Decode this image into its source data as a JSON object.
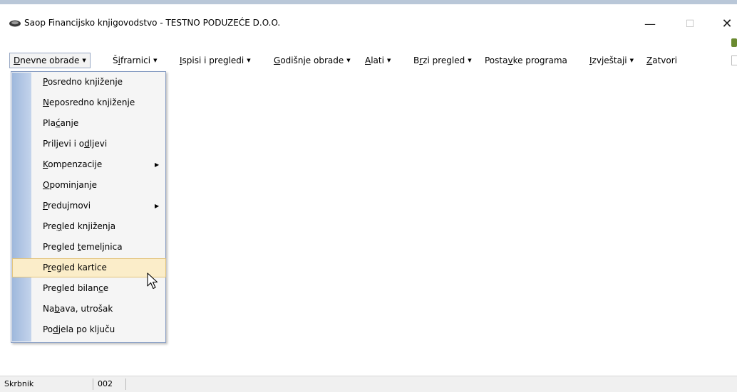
{
  "window": {
    "title": "Saop Financijsko knjigovodstvo - TESTNO PODUZEĆE D.O.O.",
    "minimize_glyph": "—",
    "maximize_glyph": "☐",
    "close_glyph": "✕"
  },
  "menubar": {
    "items": [
      {
        "label": "Dnevne obrade",
        "pre": "",
        "u": "D",
        "post": "nevne obrade",
        "dropdown": true,
        "active": true
      },
      {
        "label": "Šifrarnici",
        "pre": "Š",
        "u": "i",
        "post": "frarnici",
        "dropdown": true
      },
      {
        "label": "Ispisi i pregledi",
        "pre": "",
        "u": "I",
        "post": "spisi i pregledi",
        "dropdown": true
      },
      {
        "label": "Godišnje obrade",
        "pre": "",
        "u": "G",
        "post": "odišnje obrade",
        "dropdown": true
      },
      {
        "label": "Alati",
        "pre": "",
        "u": "A",
        "post": "lati",
        "dropdown": true
      },
      {
        "label": "Brzi pregled",
        "pre": "B",
        "u": "r",
        "post": "zi pregled",
        "dropdown": true
      },
      {
        "label": "Postavke programa",
        "pre": "Posta",
        "u": "v",
        "post": "ke programa",
        "dropdown": false
      },
      {
        "label": "Izvještaji",
        "pre": "",
        "u": "I",
        "post": "zvještaji",
        "dropdown": true
      },
      {
        "label": "Zatvori",
        "pre": "",
        "u": "Z",
        "post": "atvori",
        "dropdown": false
      }
    ]
  },
  "dropdown": {
    "items": [
      {
        "label": "Posredno knjiženje",
        "pre": "",
        "u": "P",
        "post": "osredno knjiženje"
      },
      {
        "label": "Neposredno knjiženje",
        "pre": "",
        "u": "N",
        "post": "eposredno knjiženje"
      },
      {
        "label": "Plaćanje",
        "pre": "Pla",
        "u": "ć",
        "post": "anje"
      },
      {
        "label": "Priljevi i odljevi",
        "pre": "Priljevi i o",
        "u": "d",
        "post": "ljevi"
      },
      {
        "label": "Kompenzacije",
        "pre": "",
        "u": "K",
        "post": "ompenzacije",
        "submenu": true
      },
      {
        "label": "Opominjanje",
        "pre": "",
        "u": "O",
        "post": "pominjanje"
      },
      {
        "label": "Predujmovi",
        "pre": "",
        "u": "P",
        "post": "redujmovi",
        "submenu": true
      },
      {
        "label": "Pregled knjiženja",
        "pre": "Pre",
        "u": "g",
        "post": "led knjiženja"
      },
      {
        "label": "Pregled temeljnica",
        "pre": "Pregled ",
        "u": "t",
        "post": "emeljnica"
      },
      {
        "label": "Pregled kartice",
        "pre": "P",
        "u": "r",
        "post": "egled kartice",
        "highlighted": true
      },
      {
        "label": "Pregled bilance",
        "pre": "Pregled bilan",
        "u": "c",
        "post": "e"
      },
      {
        "label": "Nabava, utrošak",
        "pre": "Na",
        "u": "b",
        "post": "ava, utrošak"
      },
      {
        "label": "Podjela po ključu",
        "pre": "Po",
        "u": "d",
        "post": "jela po ključu"
      }
    ]
  },
  "statusbar": {
    "user": "Skrbnik",
    "code": "002"
  },
  "colors": {
    "highlight_bg": "#fbedc9",
    "highlight_border": "#e3c47c",
    "dropdown_strip": "#9fb8dc",
    "menu_active_border": "#98a8c4"
  },
  "icons": {
    "app": "saop-app-icon",
    "cursor": "mouse-pointer-icon",
    "submenu": "submenu-arrow-icon"
  }
}
